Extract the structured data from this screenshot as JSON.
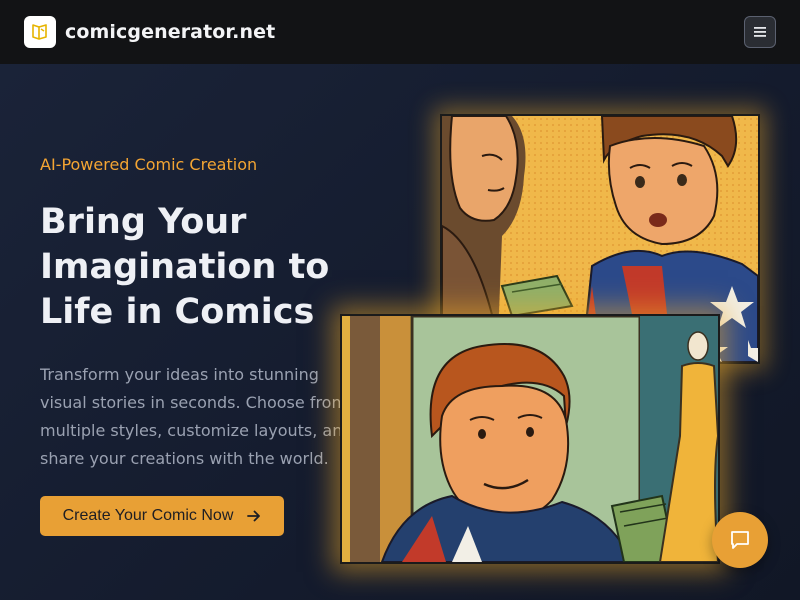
{
  "brand": {
    "name": "comicgenerator.net",
    "logo_icon": "book-icon"
  },
  "nav": {
    "menu_icon": "hamburger-menu-icon"
  },
  "hero": {
    "eyebrow": "AI-Powered Comic Creation",
    "headline_lines": [
      "Bring Your",
      "Imagination to",
      "Life in Comics"
    ],
    "description_lines": [
      "Transform your ideas into stunning",
      "visual stories in seconds. Choose from",
      "multiple styles, customize layouts, and",
      "share your creations with the world."
    ],
    "cta_label": "Create Your Comic Now",
    "cta_icon": "arrow-right-icon"
  },
  "chat": {
    "icon": "chat-bubble-icon"
  },
  "colors": {
    "accent": "#e8a035",
    "eyebrow": "#f4a533",
    "background": "#141c30",
    "navbar": "#121315"
  }
}
